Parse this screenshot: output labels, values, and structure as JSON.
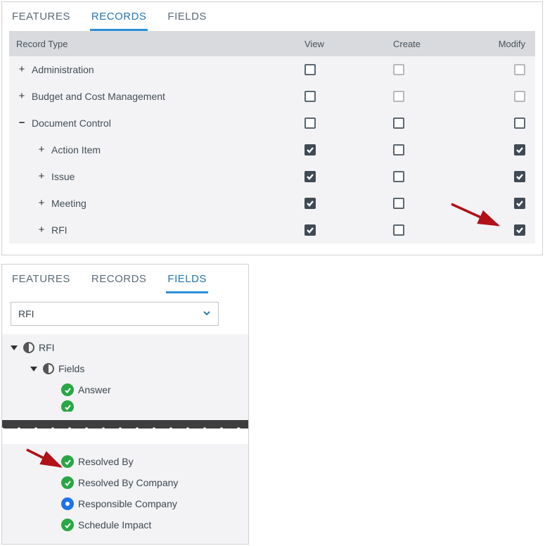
{
  "panel1": {
    "tabs": {
      "features": "FEATURES",
      "records": "RECORDS",
      "fields": "FIELDS"
    },
    "head": {
      "name": "Record Type",
      "view": "View",
      "create": "Create",
      "modify": "Modify"
    },
    "rows": {
      "r0": {
        "label": "Administration"
      },
      "r1": {
        "label": "Budget and Cost Management"
      },
      "r2": {
        "label": "Document Control"
      },
      "r3": {
        "label": "Action Item"
      },
      "r4": {
        "label": "Issue"
      },
      "r5": {
        "label": "Meeting"
      },
      "r6": {
        "label": "RFI"
      }
    }
  },
  "panel2": {
    "tabs": {
      "features": "FEATURES",
      "records": "RECORDS",
      "fields": "FIELDS"
    },
    "dropdown": {
      "value": "RFI"
    },
    "tree": {
      "n0": "RFI",
      "n1": "Fields",
      "n2": "Answer",
      "n3": "Resolved By",
      "n4": "Resolved By Company",
      "n5": "Responsible Company",
      "n6": "Schedule Impact"
    }
  }
}
